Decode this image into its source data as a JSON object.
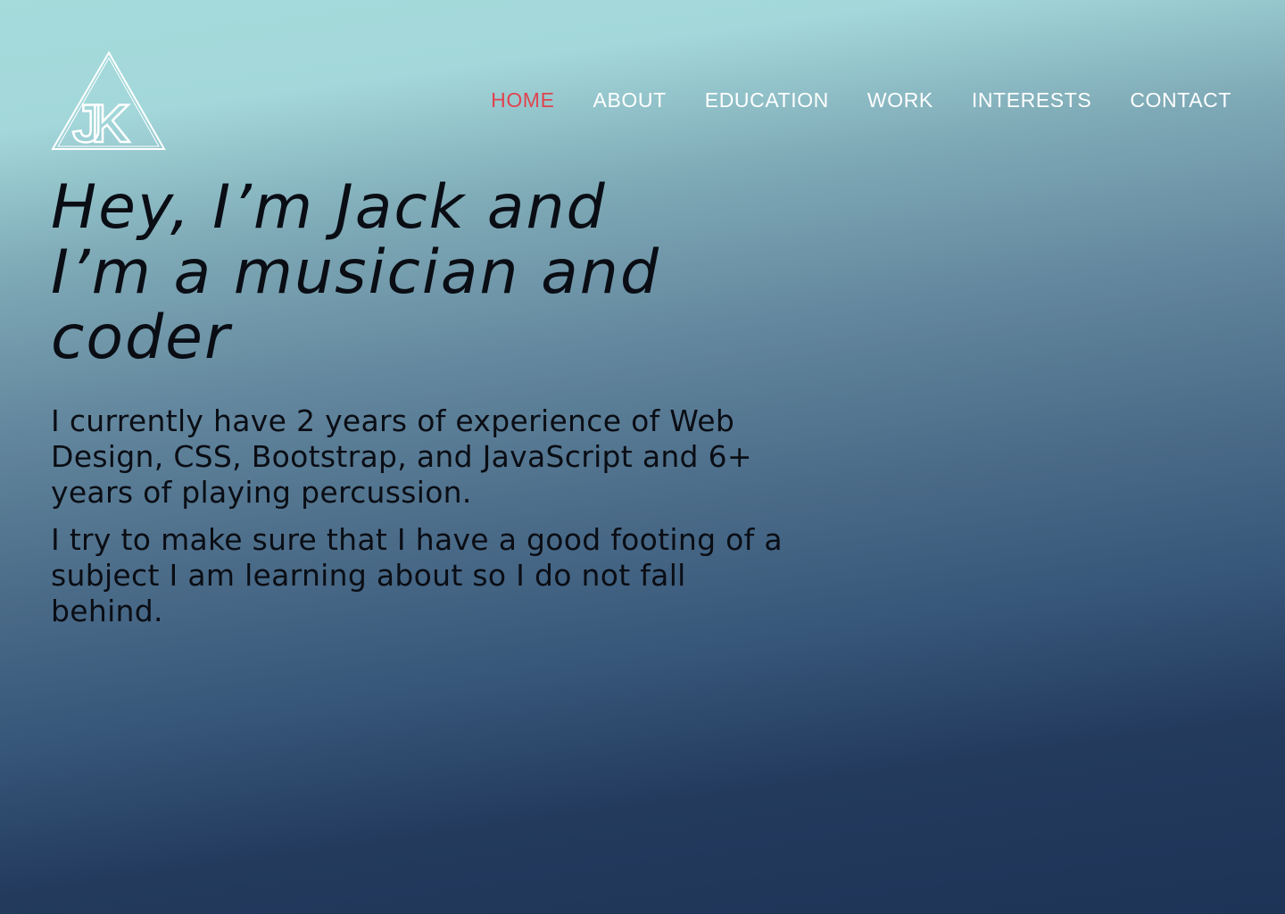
{
  "logo": {
    "text": "JK"
  },
  "nav": {
    "items": [
      {
        "label": "HOME",
        "active": true
      },
      {
        "label": "ABOUT",
        "active": false
      },
      {
        "label": "EDUCATION",
        "active": false
      },
      {
        "label": "WORK",
        "active": false
      },
      {
        "label": "INTERESTS",
        "active": false
      },
      {
        "label": "CONTACT",
        "active": false
      }
    ],
    "active_color": "#e0434f",
    "color": "#ffffff"
  },
  "hero": {
    "title_lines": [
      "Hey, I’m Jack and",
      "I’m a musician and",
      "coder"
    ],
    "paragraph1_lines": [
      "I currently have 2 years of experience of Web",
      "Design, CSS, Bootstrap, and JavaScript and 6+",
      "years of playing percussion."
    ],
    "paragraph2_lines": [
      "I try to make sure that I have a good footing of a",
      "subject I am learning about so I do not fall",
      "behind."
    ]
  },
  "colors": {
    "background_top": "#a5dbdb",
    "background_bottom": "#1e3457",
    "text": "#0a0d14"
  }
}
